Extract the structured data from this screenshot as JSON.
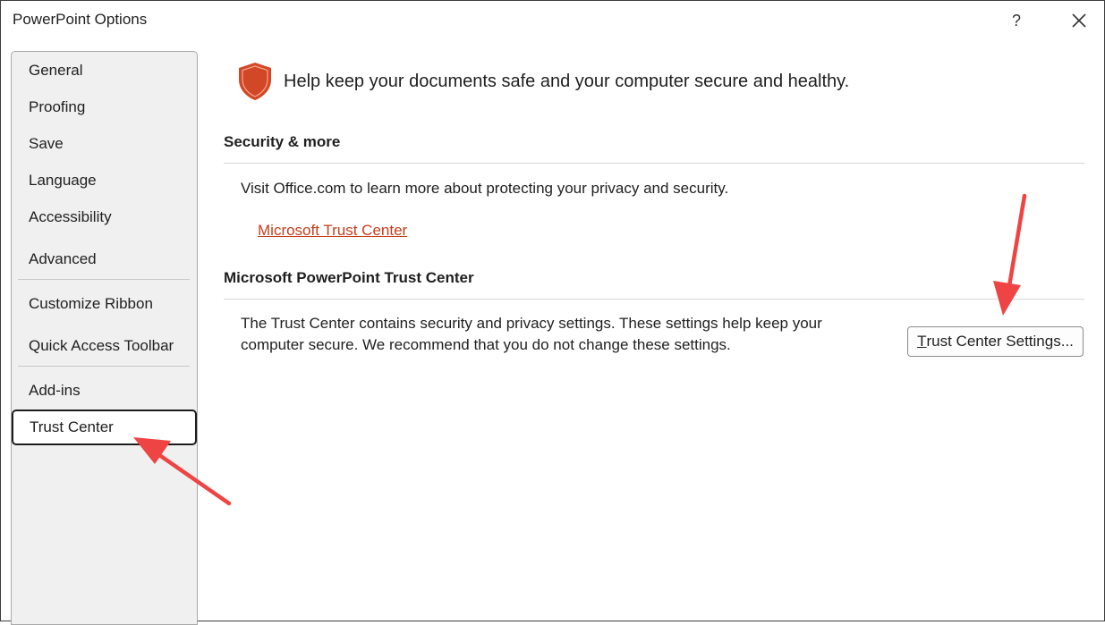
{
  "window": {
    "title": "PowerPoint Options",
    "help_glyph": "?",
    "close_icon": "close-icon"
  },
  "sidebar": {
    "items": [
      {
        "label": "General"
      },
      {
        "label": "Proofing"
      },
      {
        "label": "Save"
      },
      {
        "label": "Language"
      },
      {
        "label": "Accessibility"
      },
      {
        "label": "Advanced"
      },
      {
        "label": "Customize Ribbon"
      },
      {
        "label": "Quick Access Toolbar"
      },
      {
        "label": "Add-ins"
      },
      {
        "label": "Trust Center",
        "selected": true
      }
    ]
  },
  "main": {
    "hero": {
      "icon": "shield-icon",
      "text": "Help keep your documents safe and your computer secure and healthy."
    },
    "security": {
      "title": "Security & more",
      "description": "Visit Office.com to learn more about protecting your privacy and security.",
      "link_label": "Microsoft Trust Center"
    },
    "trust_center": {
      "title": "Microsoft PowerPoint Trust Center",
      "description_line1": "The Trust Center contains security and privacy settings. These settings help keep your",
      "description_line2": "computer secure. We recommend that you do not change these settings.",
      "button_access_key": "T",
      "button_label_rest": "rust Center Settings..."
    }
  },
  "colors": {
    "accent_link": "#c43e1c",
    "shield": "#d24726",
    "annotation_arrow": "#ef4444"
  }
}
